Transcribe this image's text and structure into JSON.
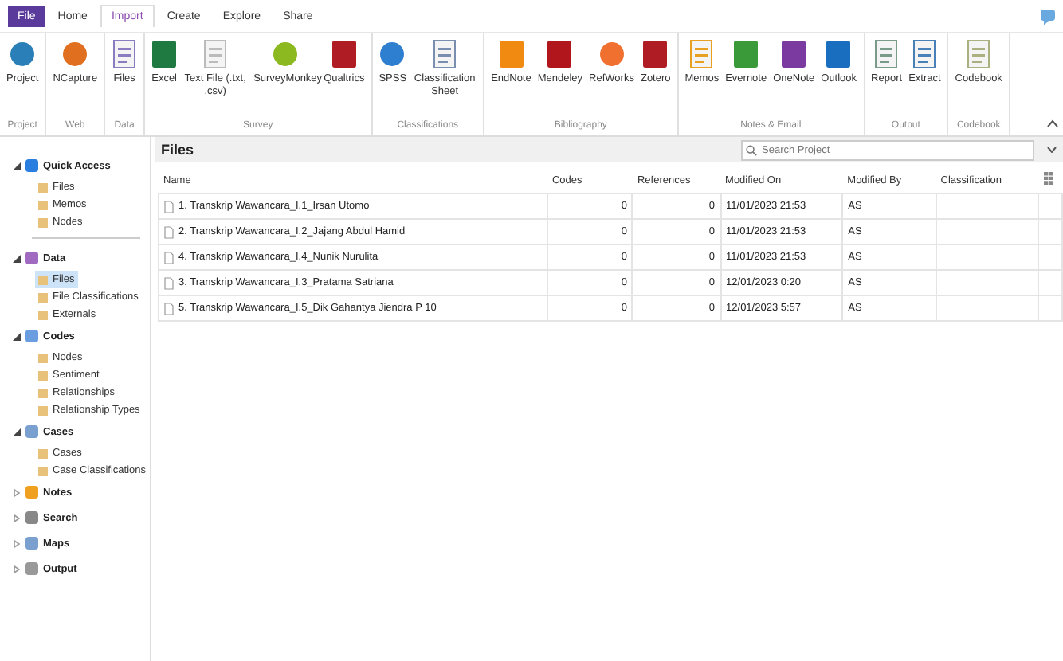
{
  "menu_tabs": [
    {
      "label": "File",
      "kind": "file",
      "selected": false
    },
    {
      "label": "Home",
      "kind": "tab",
      "selected": false
    },
    {
      "label": "Import",
      "kind": "tab",
      "selected": true
    },
    {
      "label": "Create",
      "kind": "tab",
      "selected": false
    },
    {
      "label": "Explore",
      "kind": "tab",
      "selected": false
    },
    {
      "label": "Share",
      "kind": "tab",
      "selected": false
    }
  ],
  "ribbon": [
    {
      "label": "Project",
      "buttons": [
        "Project"
      ]
    },
    {
      "label": "Web",
      "buttons": [
        "NCapture"
      ]
    },
    {
      "label": "Data",
      "buttons": [
        "Files"
      ]
    },
    {
      "label": "Survey",
      "buttons": [
        "Excel",
        "Text File (.txt, .csv)",
        "SurveyMonkey",
        "Qualtrics"
      ]
    },
    {
      "label": "Classifications",
      "buttons": [
        "SPSS",
        "Classification Sheet"
      ]
    },
    {
      "label": "Bibliography",
      "buttons": [
        "EndNote",
        "Mendeley",
        "RefWorks",
        "Zotero"
      ]
    },
    {
      "label": "Notes & Email",
      "buttons": [
        "Memos",
        "Evernote",
        "OneNote",
        "Outlook"
      ]
    },
    {
      "label": "Output",
      "buttons": [
        "Report",
        "Extract"
      ]
    },
    {
      "label": "Codebook",
      "buttons": [
        "Codebook"
      ]
    }
  ],
  "navigation": [
    {
      "label": "Quick Access",
      "expanded": true,
      "children": [
        {
          "label": "Files",
          "selected": false
        },
        {
          "label": "Memos",
          "selected": false
        },
        {
          "label": "Nodes",
          "selected": false
        }
      ]
    },
    {
      "label": "Data",
      "expanded": true,
      "children": [
        {
          "label": "Files",
          "selected": true
        },
        {
          "label": "File Classifications",
          "selected": false
        },
        {
          "label": "Externals",
          "selected": false
        }
      ]
    },
    {
      "label": "Codes",
      "expanded": true,
      "children": [
        {
          "label": "Nodes",
          "selected": false
        },
        {
          "label": "Sentiment",
          "selected": false
        },
        {
          "label": "Relationships",
          "selected": false
        },
        {
          "label": "Relationship Types",
          "selected": false
        }
      ]
    },
    {
      "label": "Cases",
      "expanded": true,
      "children": [
        {
          "label": "Cases",
          "selected": false
        },
        {
          "label": "Case Classifications",
          "selected": false
        }
      ]
    },
    {
      "label": "Notes",
      "expanded": false
    },
    {
      "label": "Search",
      "expanded": false
    },
    {
      "label": "Maps",
      "expanded": false
    },
    {
      "label": "Output",
      "expanded": false
    }
  ],
  "panel": {
    "title": "Files",
    "search": {
      "placeholder": "Search Project"
    }
  },
  "table": {
    "columns": [
      "Name",
      "Codes",
      "References",
      "Modified On",
      "Modified By",
      "Classification"
    ],
    "rows": [
      [
        "1. Transkrip Wawancara_I.1_Irsan Utomo",
        "0",
        "0",
        "11/01/2023 21:53",
        "AS",
        ""
      ],
      [
        "2. Transkrip Wawancara_I.2_Jajang Abdul Hamid",
        "0",
        "0",
        "11/01/2023 21:53",
        "AS",
        ""
      ],
      [
        "4. Transkrip Wawancara_I.4_Nunik Nurulita",
        "0",
        "0",
        "11/01/2023 21:53",
        "AS",
        ""
      ],
      [
        "3. Transkrip Wawancara_I.3_Pratama Satriana",
        "0",
        "0",
        "12/01/2023 0:20",
        "AS",
        ""
      ],
      [
        "5. Transkrip Wawancara_I.5_Dik Gahantya Jiendra P 10",
        "0",
        "0",
        "12/01/2023 5:57",
        "AS",
        ""
      ]
    ]
  }
}
